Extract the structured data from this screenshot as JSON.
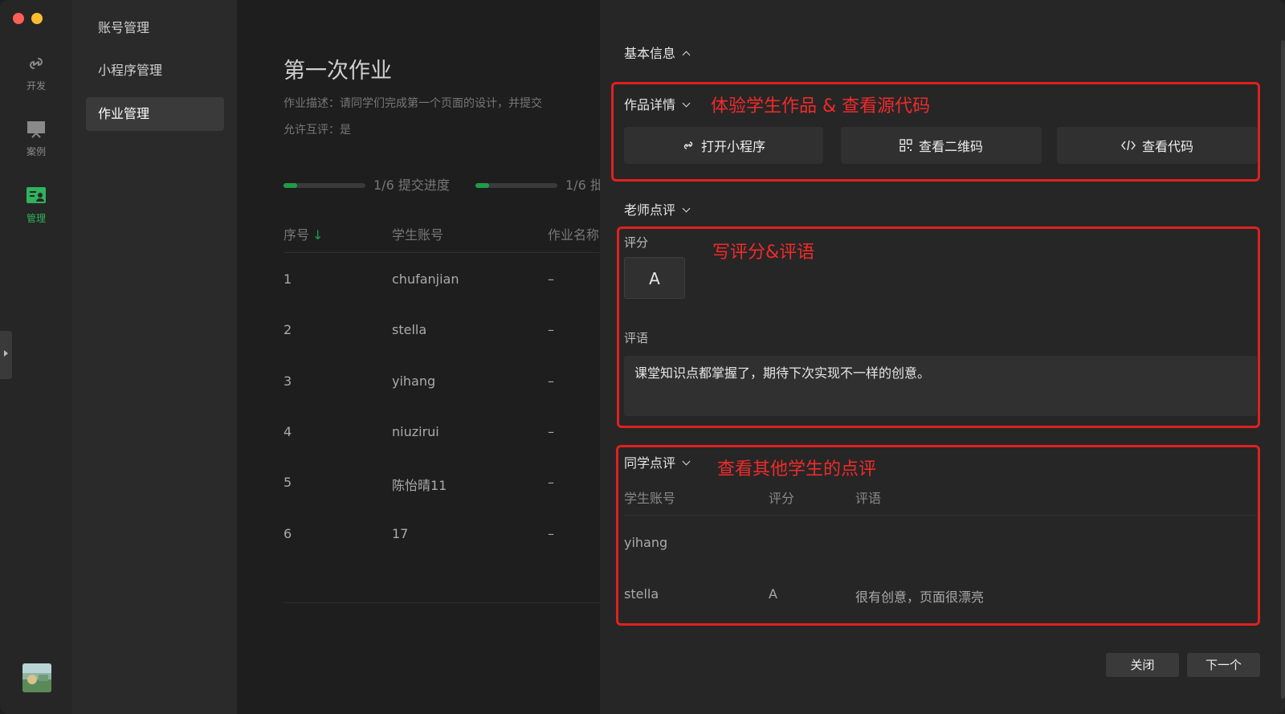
{
  "rail": [
    {
      "label": "开发",
      "icon": "link-icon"
    },
    {
      "label": "案例",
      "icon": "monitor-icon"
    },
    {
      "label": "管理",
      "icon": "manage-icon",
      "active": true
    }
  ],
  "nav": {
    "items": [
      {
        "label": "账号管理"
      },
      {
        "label": "小程序管理"
      },
      {
        "label": "作业管理",
        "active": true
      }
    ]
  },
  "assignment": {
    "title": "第一次作业",
    "description": "作业描述：请同学们完成第一个页面的设计，并提交",
    "peer_review": "允许互评：是",
    "submit_progress": {
      "label": "1/6 提交进度",
      "fraction": 0.1667
    },
    "review_progress": {
      "label": "1/6 批",
      "fraction": 0.1667
    },
    "columns": [
      "序号",
      "学生账号",
      "作业名称"
    ],
    "sort_arrow": "↓",
    "rows": [
      {
        "no": "1",
        "account": "chufanjian",
        "name": "–"
      },
      {
        "no": "2",
        "account": "stella",
        "name": "–"
      },
      {
        "no": "3",
        "account": "yihang",
        "name": "–"
      },
      {
        "no": "4",
        "account": "niuzirui",
        "name": "–"
      },
      {
        "no": "5",
        "account": "陈怡晴11",
        "name": "–"
      },
      {
        "no": "6",
        "account": "17",
        "name": "–"
      }
    ]
  },
  "drawer": {
    "basic_info": "基本信息",
    "work_details": "作品详情",
    "annot_work": "体验学生作品 & 查看源代码",
    "buttons": {
      "open_mp": "打开小程序",
      "qr": "查看二维码",
      "code": "查看代码"
    },
    "teacher_review": "老师点评",
    "annot_teacher": "写评分&评语",
    "score_label": "评分",
    "score_value": "A",
    "comment_label": "评语",
    "comment_value": "课堂知识点都掌握了，期待下次实现不一样的创意。",
    "peer_review": "同学点评",
    "annot_peer": "查看其他学生的点评",
    "peer_columns": [
      "学生账号",
      "评分",
      "评语"
    ],
    "peer_rows": [
      {
        "account": "yihang",
        "score": "",
        "comment": ""
      },
      {
        "account": "stella",
        "score": "A",
        "comment": "很有创意，页面很漂亮"
      }
    ],
    "close": "关闭",
    "next": "下一个"
  },
  "colors": {
    "accent": "#2fb35b",
    "annotation": "#e02020",
    "traffic_red": "#ff5f57",
    "traffic_yellow": "#febc2e"
  }
}
